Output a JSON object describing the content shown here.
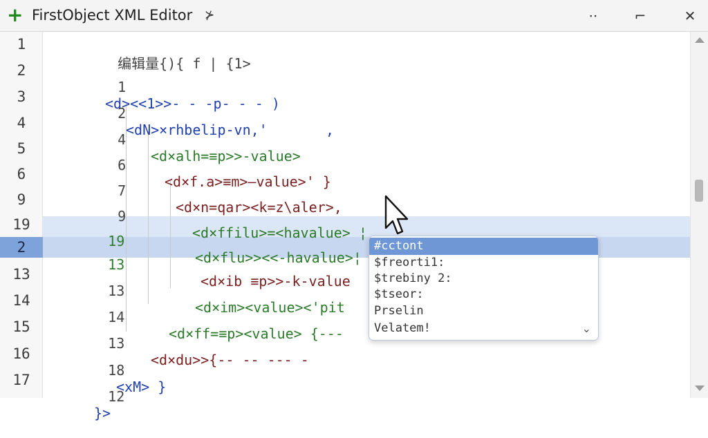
{
  "window": {
    "title": "FirstObject XML Editor",
    "plus_glyph": "+",
    "pin_glyph": "⊁",
    "controls": {
      "minimize": "⋅⋅",
      "maximize": "⌐",
      "close": "✕"
    }
  },
  "gutter": {
    "line_numbers": [
      "1",
      "2",
      "3",
      "4",
      "5",
      "6",
      "9",
      "19",
      "2",
      "13",
      "14",
      "15",
      "16",
      "17"
    ],
    "selected_index": 8
  },
  "code_lines": [
    {
      "num": "",
      "text": "编辑量{){ f | {1>"
    },
    {
      "num": "1",
      "text": "<d><<1>>- - -p- - - )"
    },
    {
      "num": "2",
      "text": "<dN>×rhbelip-vn,'       ,"
    },
    {
      "num": "4",
      "text": "<d×alh=≡p>>-value>"
    },
    {
      "num": "6",
      "text": "<d×f.a>≡m>—value>' }"
    },
    {
      "num": "7",
      "text": "<d×n=qar><k=z\\aler>,"
    },
    {
      "num": "9",
      "text": "<d×ffilu>=<havalue> ¦"
    },
    {
      "num": "19",
      "text": "<d×flu>><<-havalue>¦"
    },
    {
      "num": "13",
      "text": "<d×ib ≡p>>-k-value"
    },
    {
      "num": "13",
      "text": "<d×im><value><'pit"
    },
    {
      "num": "14",
      "text": "<d×ff=≡p><value> {---"
    },
    {
      "num": "13",
      "text": "<d×du>>{-- -- --- -"
    },
    {
      "num": "18",
      "text": "<xM> }"
    },
    {
      "num": "12",
      "text": "}>"
    }
  ],
  "autocomplete": {
    "items": [
      "#cctont",
      "$freorti1:",
      "$trebiny 2:",
      "$tseor:",
      "Prselin",
      "Velatem!"
    ],
    "selected_index": 0,
    "chevron": "⌄"
  },
  "colors": {
    "tag": "#1f3fb0",
    "value": "#2a7a2a",
    "highlight": "#dbe6f6",
    "selection": "#6f97d6",
    "plus": "#1e8a1e"
  }
}
